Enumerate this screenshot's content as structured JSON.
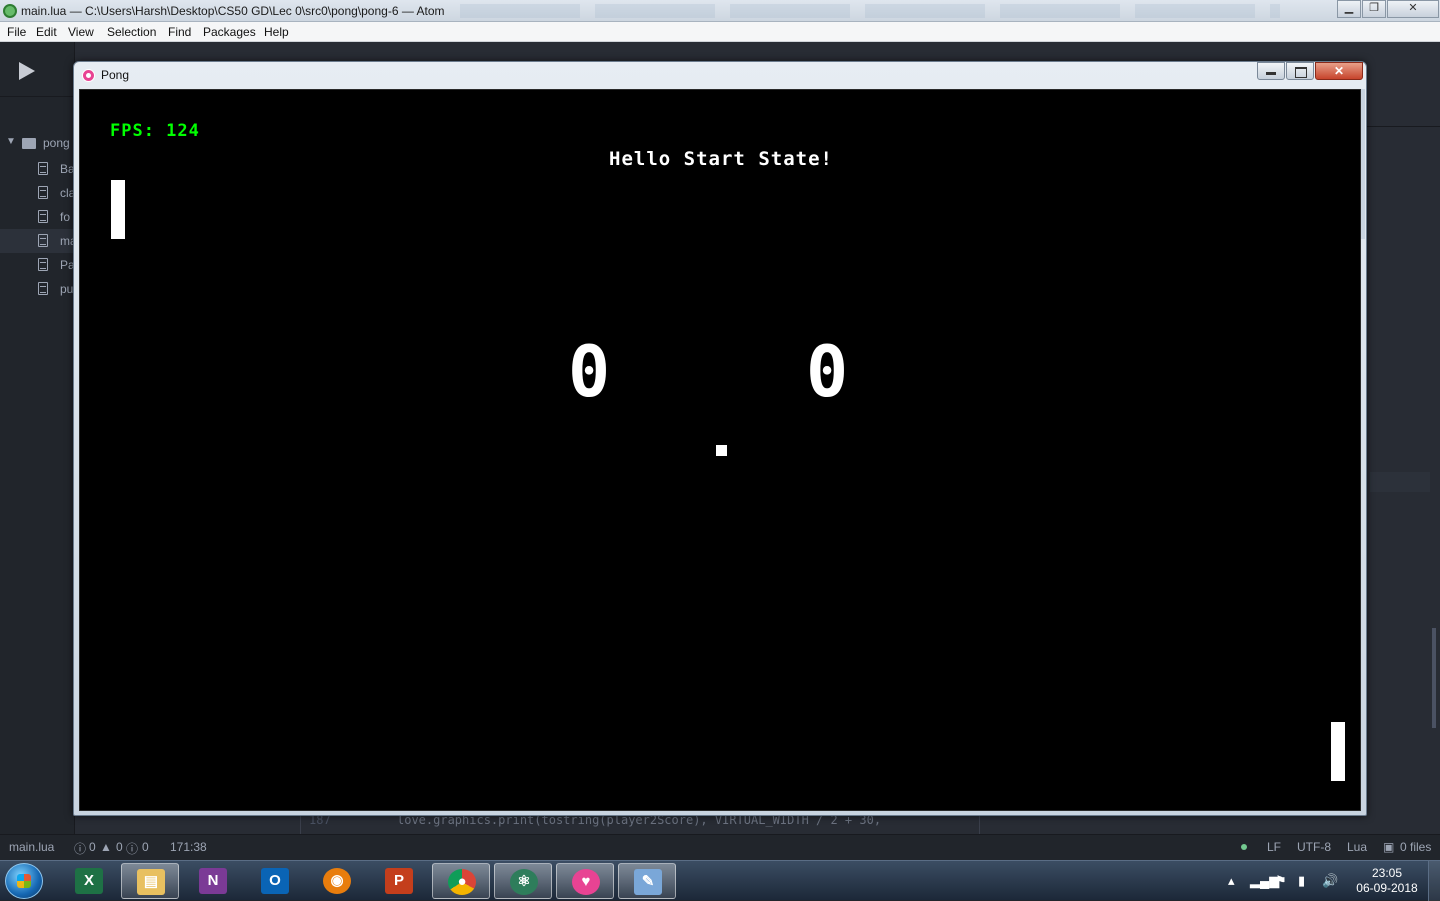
{
  "atom": {
    "window_title": "main.lua — C:\\Users\\Harsh\\Desktop\\CS50 GD\\Lec 0\\src0\\pong\\pong-6 — Atom",
    "menu": [
      "File",
      "Edit",
      "View",
      "Selection",
      "Find",
      "Packages",
      "Help"
    ],
    "tree": {
      "folder": "pong",
      "files": [
        "Ba",
        "cla",
        "fo",
        "ma",
        "Pa",
        "pu"
      ]
    },
    "code_line": {
      "number": "187",
      "text": "love.graphics.print(tostring(player2Score), VIRTUAL_WIDTH / 2 + 30,"
    },
    "status": {
      "file": "main.lua",
      "errors": "0",
      "warnings": "0",
      "infos": "0",
      "cursor": "171:38",
      "line_ending": "LF",
      "encoding": "UTF-8",
      "grammar": "Lua",
      "git": "0 files"
    }
  },
  "pong": {
    "window_title": "Pong",
    "fps_text": "FPS: 124",
    "state_message": "Hello Start State!",
    "player1_score": "0",
    "player2_score": "0"
  },
  "taskbar": {
    "apps": [
      "excel-icon",
      "explorer-icon",
      "onenote-icon",
      "outlook-icon",
      "blender-icon",
      "powerpoint-icon",
      "chrome-icon",
      "atom-icon",
      "love-icon",
      "paint-icon"
    ],
    "time": "23:05",
    "date": "06-09-2018"
  },
  "colors": {
    "fps_green": "#00ff00",
    "game_bg": "#000000",
    "atom_bg": "#282c34"
  }
}
